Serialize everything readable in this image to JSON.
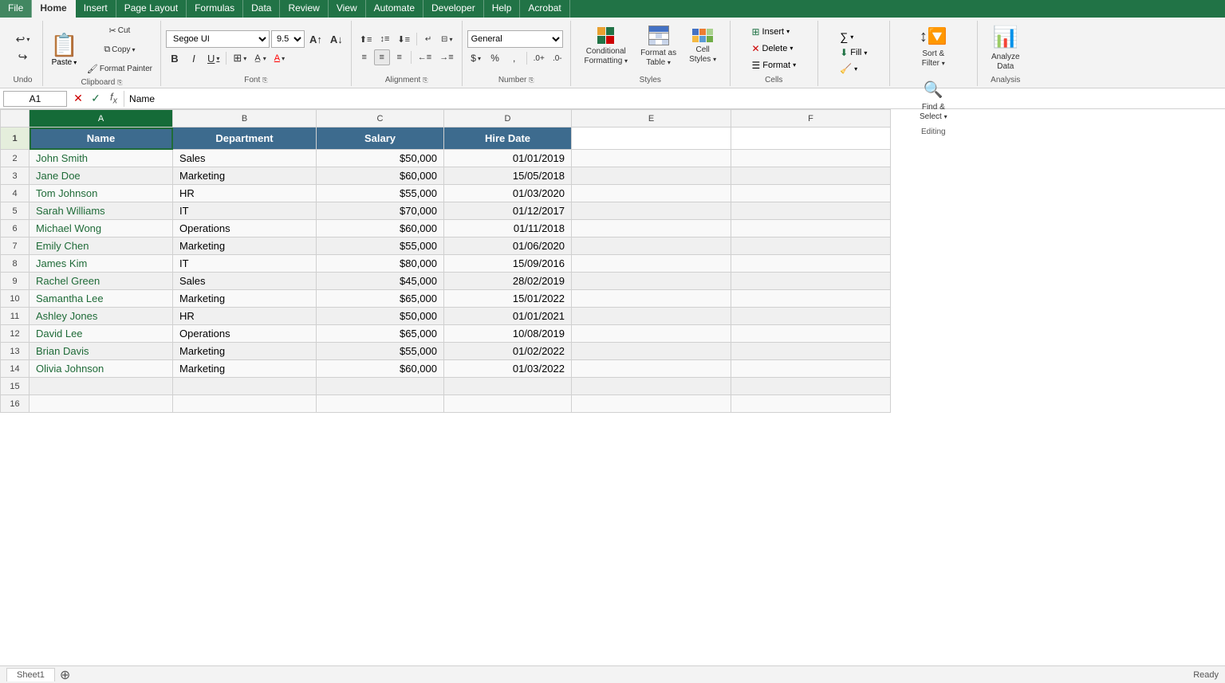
{
  "menu": {
    "items": [
      "File",
      "Home",
      "Insert",
      "Page Layout",
      "Formulas",
      "Data",
      "Review",
      "View",
      "Automate",
      "Developer",
      "Help",
      "Acrobat"
    ],
    "active": "Home"
  },
  "ribbon": {
    "groups": {
      "undo": {
        "label": "Undo",
        "buttons": [
          "↩",
          "↪"
        ]
      },
      "clipboard": {
        "label": "Clipboard",
        "paste_label": "Paste",
        "cut_label": "✂",
        "copy_label": "⧉",
        "format_painter_label": "🖌"
      },
      "font": {
        "label": "Font",
        "font_name": "Segoe UI",
        "font_size": "9.5",
        "bold": "B",
        "italic": "I",
        "underline": "U",
        "borders_label": "⊞",
        "fill_label": "A",
        "fontcolor_label": "A"
      },
      "alignment": {
        "label": "Alignment",
        "btns": [
          "≡",
          "≡",
          "≡",
          "↕",
          "🔃"
        ],
        "btns2": [
          "⬛",
          "⬛",
          "⬛",
          "⬛",
          "⬛"
        ]
      },
      "number": {
        "label": "Number",
        "format": "General",
        "btns": [
          "$",
          "%",
          ",",
          ".0↑",
          ".0↓"
        ]
      },
      "styles": {
        "label": "Styles",
        "conditional_formatting": "Conditional\nFormatting",
        "format_as_table": "Format as\nTable",
        "cell_styles": "Cell\nStyles"
      },
      "cells": {
        "label": "Cells",
        "insert": "Insert",
        "delete": "Delete",
        "format": "Format"
      },
      "editing": {
        "label": "Editing",
        "autosum": "∑",
        "fill": "⬇",
        "clear": "🧹",
        "sort_filter": "Sort &\nFilter",
        "find_select": "Find &\nSelect"
      },
      "analysis": {
        "label": "Analysis",
        "analyze_data": "Analyze\nData"
      }
    }
  },
  "formula_bar": {
    "cell_ref": "A1",
    "formula": "Name"
  },
  "columns": {
    "headers": [
      "A",
      "B",
      "C",
      "D",
      "E",
      "F"
    ],
    "widths": [
      180,
      180,
      160,
      160,
      160,
      160
    ]
  },
  "rows": {
    "header": [
      "Name",
      "Department",
      "Salary",
      "Hire Date"
    ],
    "data": [
      [
        "John Smith",
        "Sales",
        "$50,000",
        "01/01/2019"
      ],
      [
        "Jane Doe",
        "Marketing",
        "$60,000",
        "15/05/2018"
      ],
      [
        "Tom Johnson",
        "HR",
        "$55,000",
        "01/03/2020"
      ],
      [
        "Sarah Williams",
        "IT",
        "$70,000",
        "01/12/2017"
      ],
      [
        "Michael Wong",
        "Operations",
        "$60,000",
        "01/11/2018"
      ],
      [
        "Emily Chen",
        "Marketing",
        "$55,000",
        "01/06/2020"
      ],
      [
        "James Kim",
        "IT",
        "$80,000",
        "15/09/2016"
      ],
      [
        "Rachel Green",
        "Sales",
        "$45,000",
        "28/02/2019"
      ],
      [
        "Samantha Lee",
        "Marketing",
        "$65,000",
        "15/01/2022"
      ],
      [
        "Ashley Jones",
        "HR",
        "$50,000",
        "01/01/2021"
      ],
      [
        "David Lee",
        "Operations",
        "$65,000",
        "10/08/2019"
      ],
      [
        "Brian Davis",
        "Marketing",
        "$55,000",
        "01/02/2022"
      ],
      [
        "Olivia Johnson",
        "Marketing",
        "$60,000",
        "01/03/2022"
      ]
    ]
  },
  "sheet": {
    "name": "Sheet1",
    "status": "Ready"
  }
}
